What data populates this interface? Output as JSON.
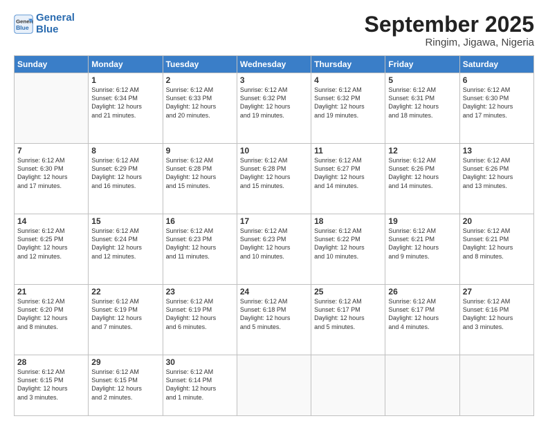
{
  "header": {
    "logo_line1": "General",
    "logo_line2": "Blue",
    "month": "September 2025",
    "location": "Ringim, Jigawa, Nigeria"
  },
  "weekdays": [
    "Sunday",
    "Monday",
    "Tuesday",
    "Wednesday",
    "Thursday",
    "Friday",
    "Saturday"
  ],
  "weeks": [
    [
      {
        "day": "",
        "info": ""
      },
      {
        "day": "1",
        "info": "Sunrise: 6:12 AM\nSunset: 6:34 PM\nDaylight: 12 hours\nand 21 minutes."
      },
      {
        "day": "2",
        "info": "Sunrise: 6:12 AM\nSunset: 6:33 PM\nDaylight: 12 hours\nand 20 minutes."
      },
      {
        "day": "3",
        "info": "Sunrise: 6:12 AM\nSunset: 6:32 PM\nDaylight: 12 hours\nand 19 minutes."
      },
      {
        "day": "4",
        "info": "Sunrise: 6:12 AM\nSunset: 6:32 PM\nDaylight: 12 hours\nand 19 minutes."
      },
      {
        "day": "5",
        "info": "Sunrise: 6:12 AM\nSunset: 6:31 PM\nDaylight: 12 hours\nand 18 minutes."
      },
      {
        "day": "6",
        "info": "Sunrise: 6:12 AM\nSunset: 6:30 PM\nDaylight: 12 hours\nand 17 minutes."
      }
    ],
    [
      {
        "day": "7",
        "info": "Sunrise: 6:12 AM\nSunset: 6:30 PM\nDaylight: 12 hours\nand 17 minutes."
      },
      {
        "day": "8",
        "info": "Sunrise: 6:12 AM\nSunset: 6:29 PM\nDaylight: 12 hours\nand 16 minutes."
      },
      {
        "day": "9",
        "info": "Sunrise: 6:12 AM\nSunset: 6:28 PM\nDaylight: 12 hours\nand 15 minutes."
      },
      {
        "day": "10",
        "info": "Sunrise: 6:12 AM\nSunset: 6:28 PM\nDaylight: 12 hours\nand 15 minutes."
      },
      {
        "day": "11",
        "info": "Sunrise: 6:12 AM\nSunset: 6:27 PM\nDaylight: 12 hours\nand 14 minutes."
      },
      {
        "day": "12",
        "info": "Sunrise: 6:12 AM\nSunset: 6:26 PM\nDaylight: 12 hours\nand 14 minutes."
      },
      {
        "day": "13",
        "info": "Sunrise: 6:12 AM\nSunset: 6:26 PM\nDaylight: 12 hours\nand 13 minutes."
      }
    ],
    [
      {
        "day": "14",
        "info": "Sunrise: 6:12 AM\nSunset: 6:25 PM\nDaylight: 12 hours\nand 12 minutes."
      },
      {
        "day": "15",
        "info": "Sunrise: 6:12 AM\nSunset: 6:24 PM\nDaylight: 12 hours\nand 12 minutes."
      },
      {
        "day": "16",
        "info": "Sunrise: 6:12 AM\nSunset: 6:23 PM\nDaylight: 12 hours\nand 11 minutes."
      },
      {
        "day": "17",
        "info": "Sunrise: 6:12 AM\nSunset: 6:23 PM\nDaylight: 12 hours\nand 10 minutes."
      },
      {
        "day": "18",
        "info": "Sunrise: 6:12 AM\nSunset: 6:22 PM\nDaylight: 12 hours\nand 10 minutes."
      },
      {
        "day": "19",
        "info": "Sunrise: 6:12 AM\nSunset: 6:21 PM\nDaylight: 12 hours\nand 9 minutes."
      },
      {
        "day": "20",
        "info": "Sunrise: 6:12 AM\nSunset: 6:21 PM\nDaylight: 12 hours\nand 8 minutes."
      }
    ],
    [
      {
        "day": "21",
        "info": "Sunrise: 6:12 AM\nSunset: 6:20 PM\nDaylight: 12 hours\nand 8 minutes."
      },
      {
        "day": "22",
        "info": "Sunrise: 6:12 AM\nSunset: 6:19 PM\nDaylight: 12 hours\nand 7 minutes."
      },
      {
        "day": "23",
        "info": "Sunrise: 6:12 AM\nSunset: 6:19 PM\nDaylight: 12 hours\nand 6 minutes."
      },
      {
        "day": "24",
        "info": "Sunrise: 6:12 AM\nSunset: 6:18 PM\nDaylight: 12 hours\nand 5 minutes."
      },
      {
        "day": "25",
        "info": "Sunrise: 6:12 AM\nSunset: 6:17 PM\nDaylight: 12 hours\nand 5 minutes."
      },
      {
        "day": "26",
        "info": "Sunrise: 6:12 AM\nSunset: 6:17 PM\nDaylight: 12 hours\nand 4 minutes."
      },
      {
        "day": "27",
        "info": "Sunrise: 6:12 AM\nSunset: 6:16 PM\nDaylight: 12 hours\nand 3 minutes."
      }
    ],
    [
      {
        "day": "28",
        "info": "Sunrise: 6:12 AM\nSunset: 6:15 PM\nDaylight: 12 hours\nand 3 minutes."
      },
      {
        "day": "29",
        "info": "Sunrise: 6:12 AM\nSunset: 6:15 PM\nDaylight: 12 hours\nand 2 minutes."
      },
      {
        "day": "30",
        "info": "Sunrise: 6:12 AM\nSunset: 6:14 PM\nDaylight: 12 hours\nand 1 minute."
      },
      {
        "day": "",
        "info": ""
      },
      {
        "day": "",
        "info": ""
      },
      {
        "day": "",
        "info": ""
      },
      {
        "day": "",
        "info": ""
      }
    ]
  ]
}
